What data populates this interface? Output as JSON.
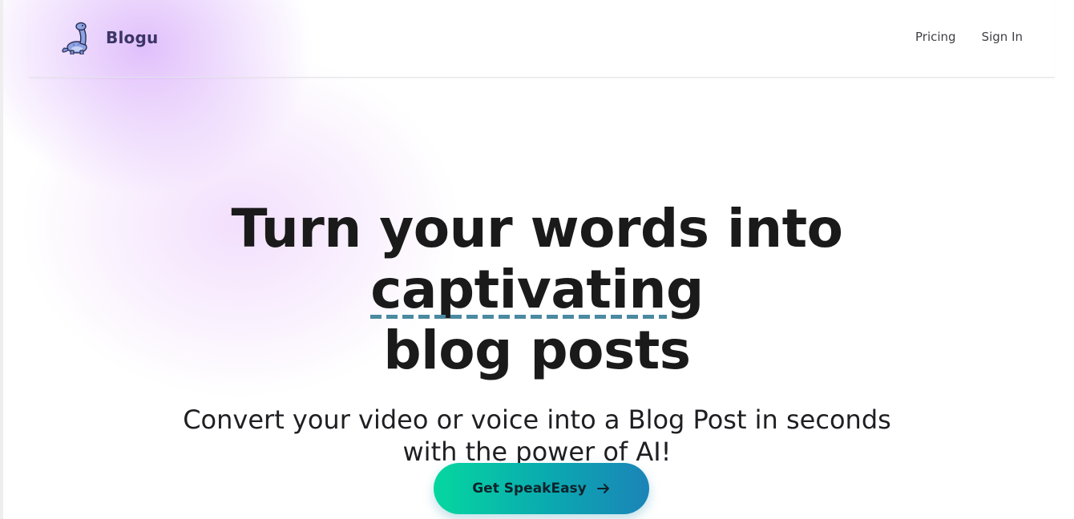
{
  "brand": {
    "name": "Blogu",
    "logo_icon": "dinosaur-icon"
  },
  "nav": {
    "links": [
      {
        "label": "Pricing"
      },
      {
        "label": "Sign In"
      }
    ]
  },
  "hero": {
    "headline_part1": "Turn your words into ",
    "headline_highlight": "captivating",
    "headline_part2": "blog posts",
    "subheadline_line1": "Convert your video or voice into a Blog Post in seconds",
    "subheadline_line2": "with the power of AI!"
  },
  "cta": {
    "label": "Get SpeakEasy",
    "icon": "arrow-right-icon"
  },
  "colors": {
    "brand_text": "#3b3566",
    "headline_text": "#1a1a1a",
    "highlight_underline": "#4a8aa1",
    "cta_gradient_start": "#05d7a0",
    "cta_gradient_end": "#1b84b8",
    "glow": "#d6aafa"
  }
}
